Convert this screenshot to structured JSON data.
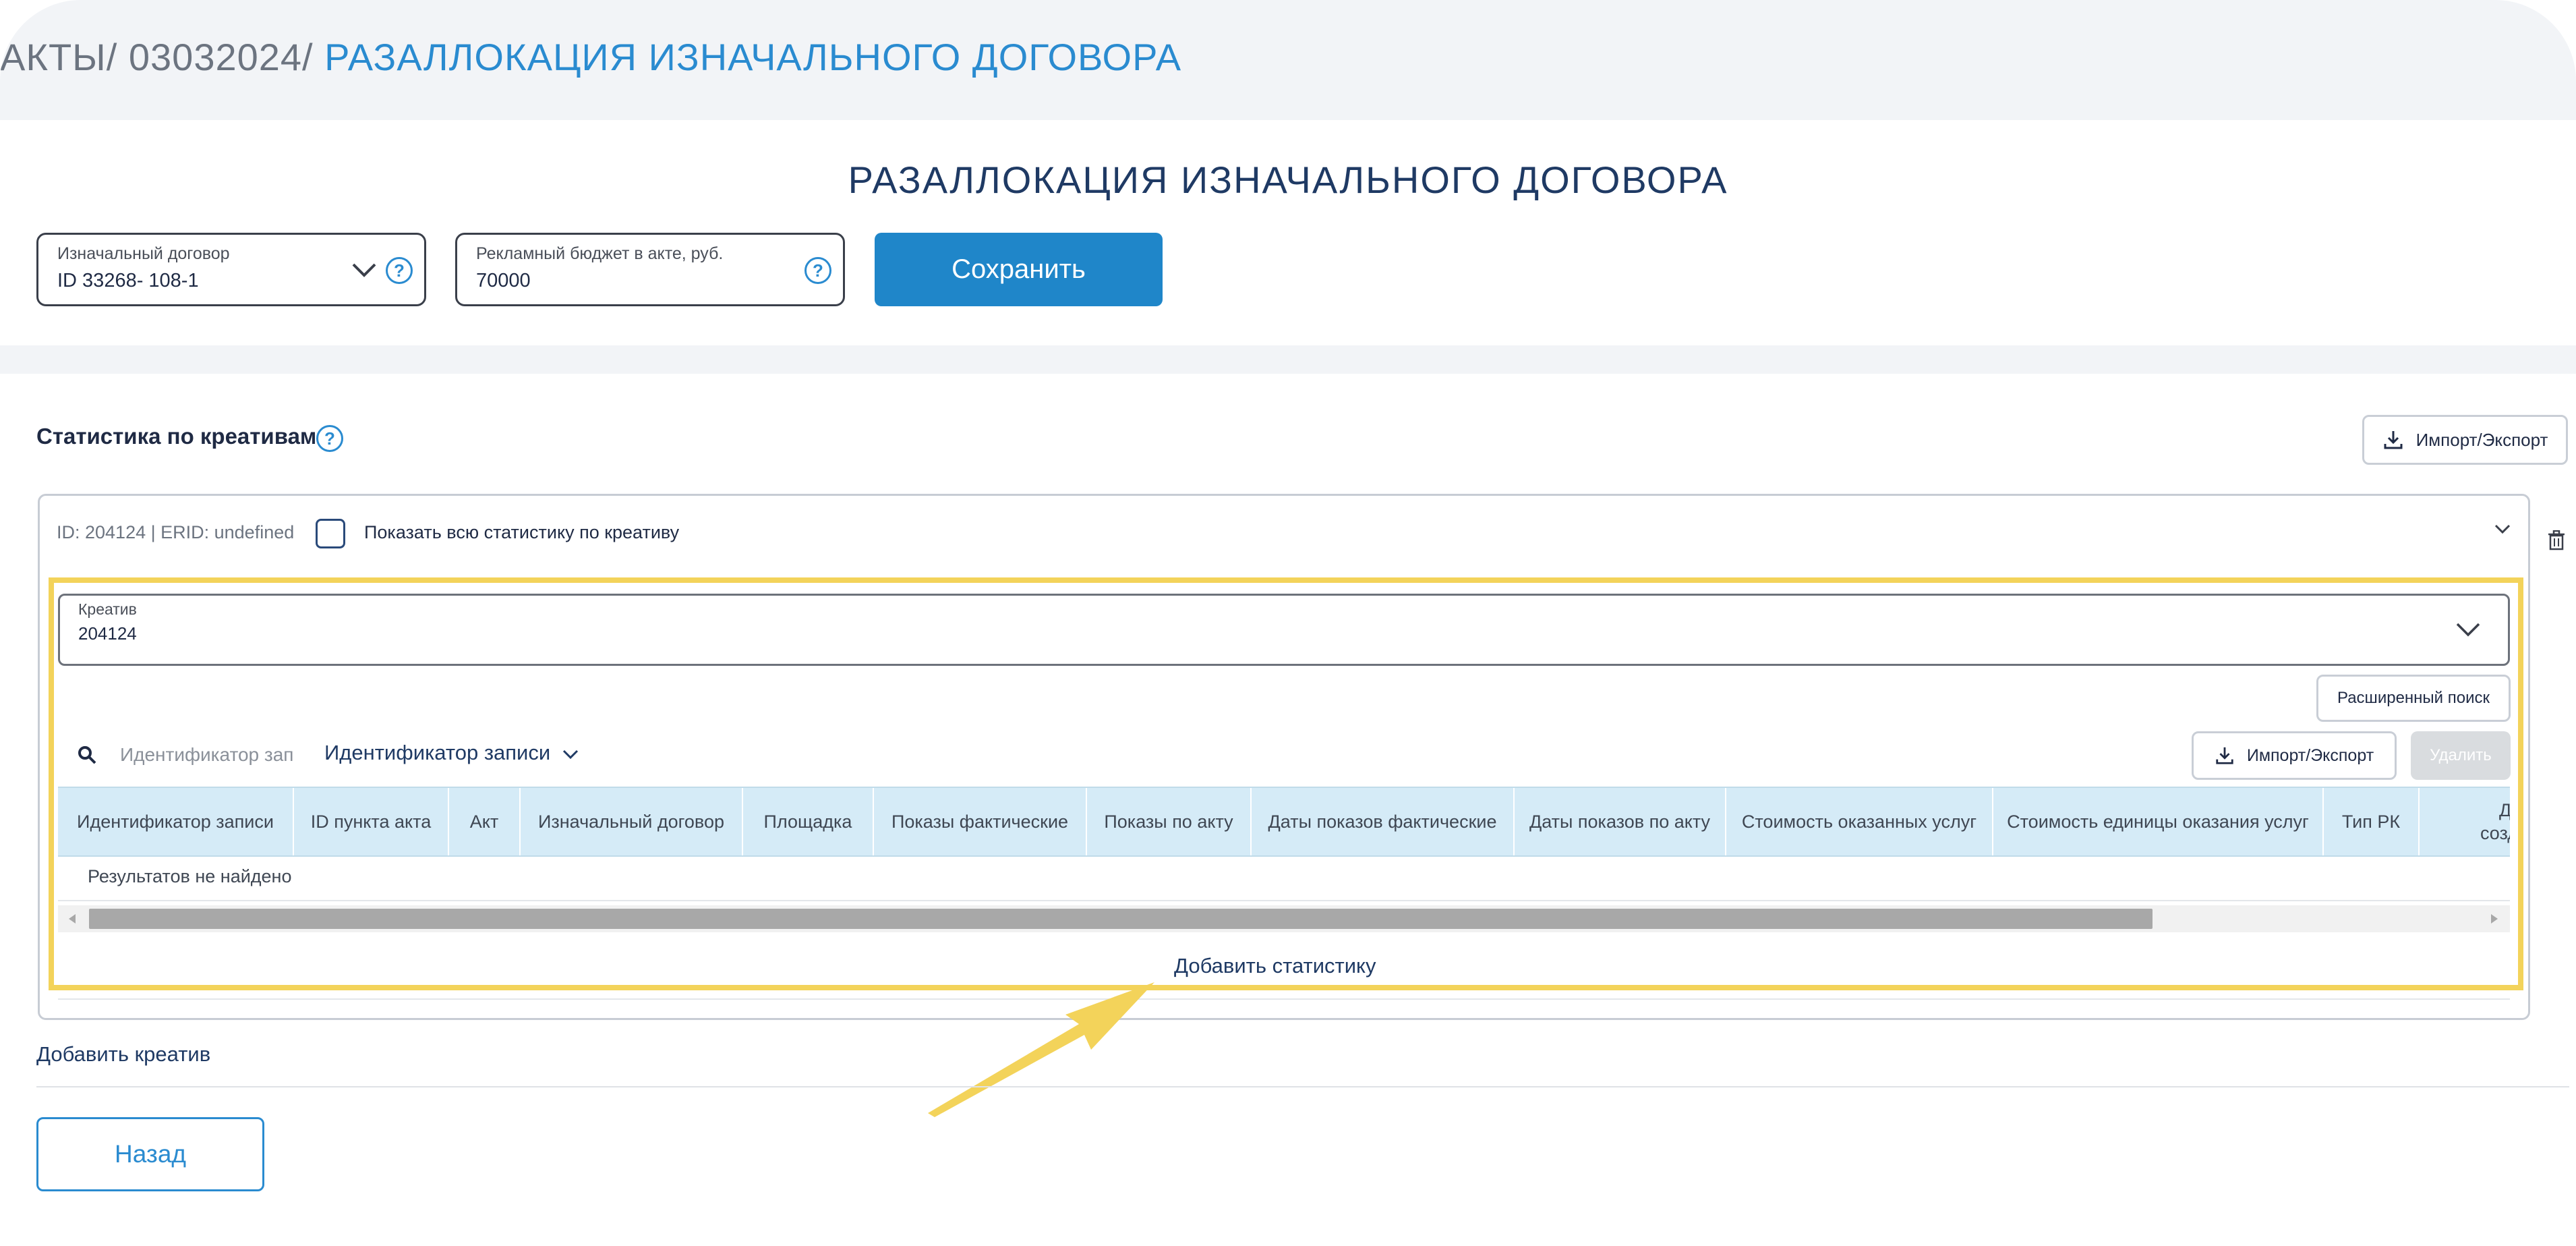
{
  "breadcrumb": {
    "item1": "АКТЫ",
    "item2": "03032024",
    "current": "РАЗАЛЛОКАЦИЯ ИЗНАЧАЛЬНОГО ДОГОВОРА",
    "separator": "/"
  },
  "page_title": "РАЗАЛЛОКАЦИЯ ИЗНАЧАЛЬНОГО ДОГОВОРА",
  "form": {
    "contract_label": "Изначальный договор",
    "contract_value": "ID 33268- 108-1",
    "budget_label": "Рекламный бюджет в акте, руб.",
    "budget_value": "70000",
    "save_label": "Сохранить"
  },
  "stats_section": {
    "title": "Статистика по креативам",
    "import_export_label": "Импорт/Экспорт"
  },
  "creative_card": {
    "id_text": "ID: 204124 | ERID: undefined",
    "show_all_label": "Показать всю статистику по креативу",
    "creative_label": "Креатив",
    "creative_value": "204124",
    "advanced_search_label": "Расширенный поиск",
    "search_placeholder": "Идентификатор зап",
    "filter_field_label": "Идентификатор записи",
    "import_export_label": "Импорт/Экспорт",
    "delete_label": "Удалить",
    "columns": [
      "Идентификатор записи",
      "ID пункта акта",
      "Акт",
      "Изначальный договор",
      "Площадка",
      "Показы фактические",
      "Показы по акту",
      "Даты показов фактические",
      "Даты показов по акту",
      "Стоимость оказанных услуг",
      "Стоимость единицы оказания услуг",
      "Тип РК",
      "Дата создания"
    ],
    "empty_text": "Результатов не найдено",
    "add_stat_label": "Добавить статистику"
  },
  "add_creative_label": "Добавить креатив",
  "back_label": "Назад",
  "colors": {
    "accent": "#2a8bd0",
    "primary_button": "#1f86c9",
    "table_header": "#d5ebf7",
    "highlight": "#f3d35a"
  }
}
